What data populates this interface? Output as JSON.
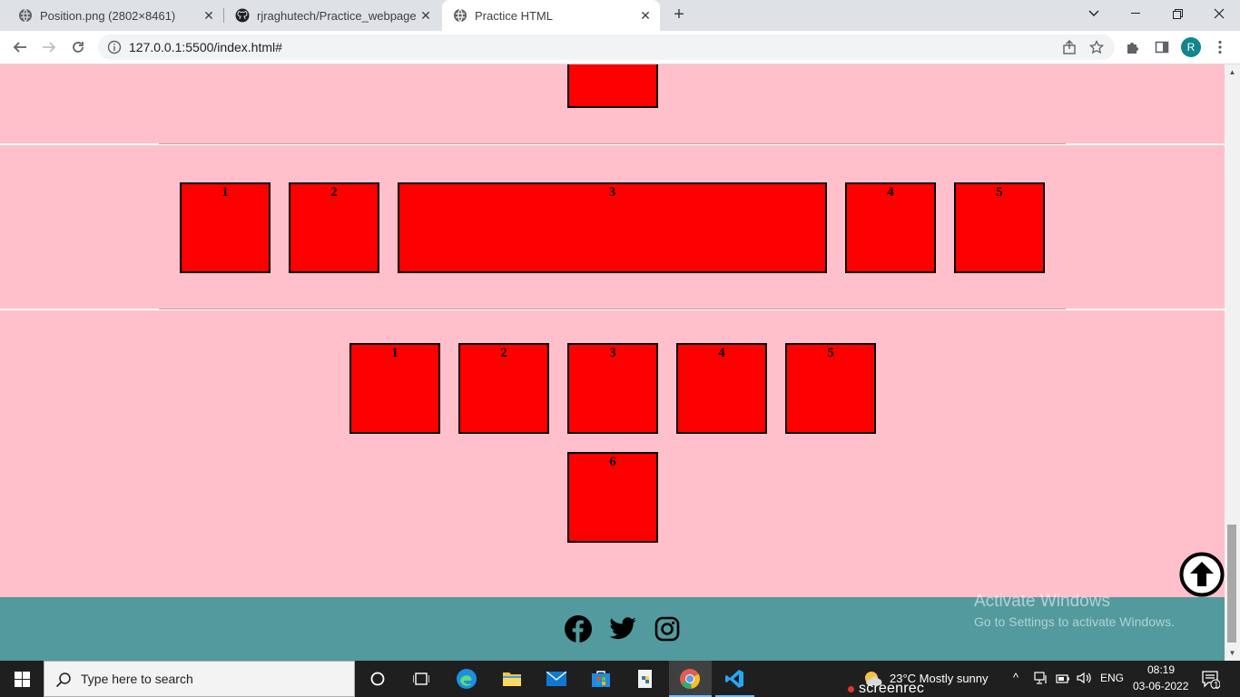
{
  "browser": {
    "tabs": [
      {
        "title": "Position.png (2802×8461)",
        "active": false
      },
      {
        "title": "rjraghutech/Practice_webpage",
        "active": false
      },
      {
        "title": "Practice HTML",
        "active": true
      }
    ],
    "url": "127.0.0.1:5500/index.html#",
    "profile_initial": "R"
  },
  "page": {
    "background": "#ffc0cb",
    "box_color": "#ff0000",
    "row1_labels": [
      "1",
      "2",
      "3",
      "4",
      "5"
    ],
    "row2_labels": [
      "1",
      "2",
      "3",
      "4",
      "5"
    ],
    "row3_labels": [
      "6"
    ],
    "footer_color": "#529a9d",
    "social_icons": [
      "facebook-icon",
      "twitter-icon",
      "instagram-icon"
    ]
  },
  "watermark": {
    "title": "Activate Windows",
    "subtitle": "Go to Settings to activate Windows."
  },
  "taskbar": {
    "search_placeholder": "Type here to search",
    "weather": "23°C  Mostly sunny",
    "language": "ENG",
    "time": "08:19",
    "date": "03-06-2022",
    "notification_count": "1",
    "recorder_label": "screenrec"
  }
}
